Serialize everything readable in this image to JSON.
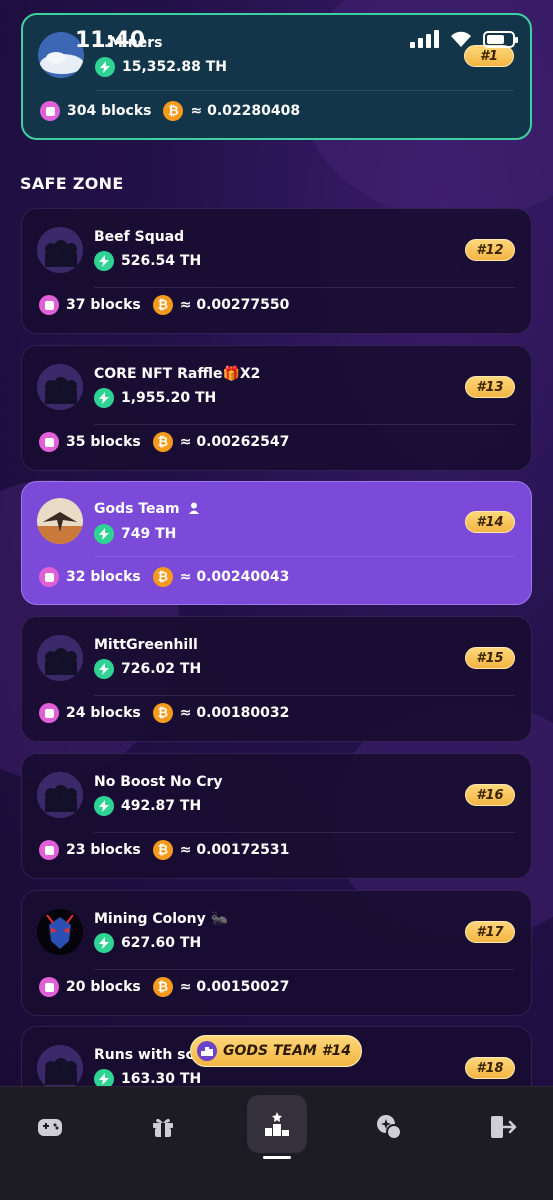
{
  "status_bar": {
    "time": "11:40"
  },
  "top_entry": {
    "name": "…Miners",
    "hashrate": "15,352.88 TH",
    "blocks": "304 blocks",
    "btc": "≈ 0.02280408",
    "rank": "#1"
  },
  "section_title": "SAFE ZONE",
  "entries": [
    {
      "name": "Beef Squad",
      "hashrate": "526.54 TH",
      "blocks": "37 blocks",
      "btc": "≈ 0.00277550",
      "rank": "#12"
    },
    {
      "name": "CORE NFT Raffle🎁X2",
      "hashrate": "1,955.20 TH",
      "blocks": "35 blocks",
      "btc": "≈ 0.00262547",
      "rank": "#13"
    },
    {
      "name": "Gods Team",
      "hashrate": "749 TH",
      "blocks": "32 blocks",
      "btc": "≈ 0.00240043",
      "rank": "#14"
    },
    {
      "name": "MittGreenhill",
      "hashrate": "726.02 TH",
      "blocks": "24 blocks",
      "btc": "≈ 0.00180032",
      "rank": "#15"
    },
    {
      "name": "No Boost No Cry",
      "hashrate": "492.87 TH",
      "blocks": "23 blocks",
      "btc": "≈ 0.00172531",
      "rank": "#16"
    },
    {
      "name": "Mining Colony 🐜",
      "hashrate": "627.60 TH",
      "blocks": "20 blocks",
      "btc": "≈ 0.00150027",
      "rank": "#17"
    },
    {
      "name": "Runs with sciss",
      "hashrate": "163.30 TH",
      "blocks": "",
      "btc": "",
      "rank": "#18"
    }
  ],
  "floating_badge": "GODS TEAM #14",
  "nav": {
    "items": [
      {
        "icon": "gamepad-icon"
      },
      {
        "icon": "gift-icon"
      },
      {
        "icon": "leaderboard-icon",
        "active": true
      },
      {
        "icon": "coin-swap-icon"
      },
      {
        "icon": "exit-icon"
      }
    ]
  },
  "colors": {
    "accent_green": "#2fd394",
    "rank_gold": "#f2b544",
    "highlight_purple": "#7b4ad8",
    "btc_orange": "#f59a1c",
    "blocks_pink": "#e060d8"
  }
}
